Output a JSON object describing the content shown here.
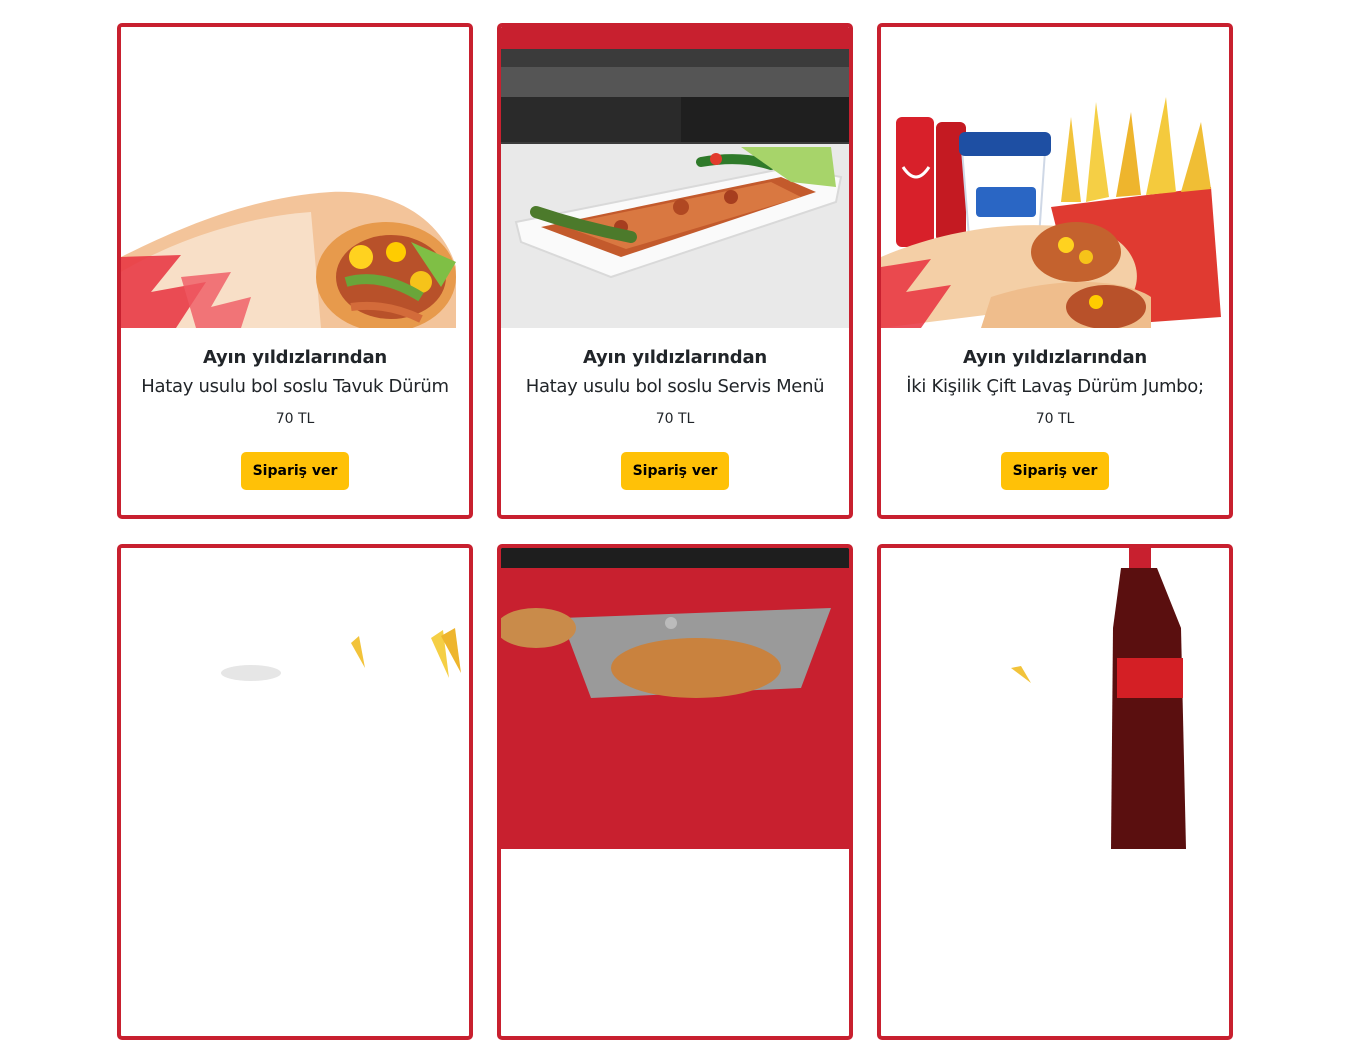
{
  "products": [
    {
      "title": "Ayın yıldızlarından",
      "desc": "Hatay usulu bol soslu Tavuk Dürüm",
      "price": "70 TL",
      "button": "Sipariş ver",
      "image": "tavuk-durum-image"
    },
    {
      "title": "Ayın yıldızlarından",
      "desc": "Hatay usulu bol soslu Servis Menü",
      "price": "70 TL",
      "button": "Sipariş ver",
      "image": "servis-menu-image"
    },
    {
      "title": "Ayın yıldızlarından",
      "desc": "İki Kişilik Çift Lavaş Dürüm Jumbo;",
      "price": "70 TL",
      "button": "Sipariş ver",
      "image": "cift-lavas-durum-image"
    }
  ],
  "colors": {
    "card_border": "#c8202f",
    "button_bg": "#ffc107"
  }
}
